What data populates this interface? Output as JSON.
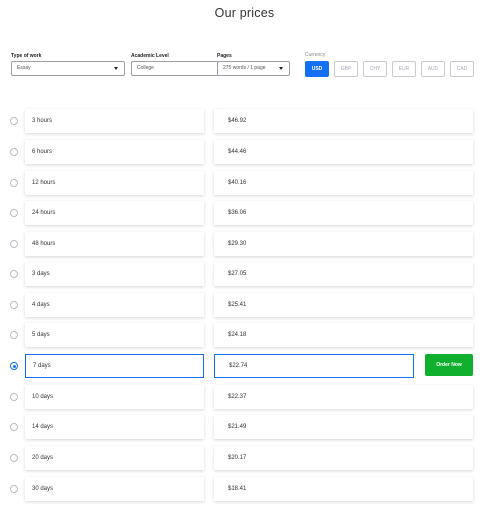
{
  "page": {
    "title": "Our prices"
  },
  "filters": {
    "type_of_work": {
      "label": "Type of work",
      "value": "Essay"
    },
    "academic_level": {
      "label": "Academic Level",
      "value": "College"
    },
    "pages": {
      "label": "Pages",
      "value": "275 words / 1 page"
    },
    "currency": {
      "label": "Currency",
      "options": [
        "USD",
        "GBP",
        "CHY",
        "EUR",
        "AUD",
        "CAD"
      ],
      "selected": "USD"
    }
  },
  "rows": [
    {
      "deadline": "3 hours",
      "price": "$46.92"
    },
    {
      "deadline": "6 hours",
      "price": "$44.46"
    },
    {
      "deadline": "12 hours",
      "price": "$40.16"
    },
    {
      "deadline": "24 hours",
      "price": "$36.06"
    },
    {
      "deadline": "48 hours",
      "price": "$29.30"
    },
    {
      "deadline": "3 days",
      "price": "$27.05"
    },
    {
      "deadline": "4 days",
      "price": "$25.41"
    },
    {
      "deadline": "5 days",
      "price": "$24.18"
    },
    {
      "deadline": "7 days",
      "price": "$22.74"
    },
    {
      "deadline": "10 days",
      "price": "$22.37"
    },
    {
      "deadline": "14 days",
      "price": "$21.49"
    },
    {
      "deadline": "20 days",
      "price": "$20.17"
    },
    {
      "deadline": "30 days",
      "price": "$18.41"
    }
  ],
  "selected_row": "7 days",
  "order_button_label": "Order Now",
  "colors": {
    "accent": "#1370f2",
    "order_button": "#10b02e"
  }
}
